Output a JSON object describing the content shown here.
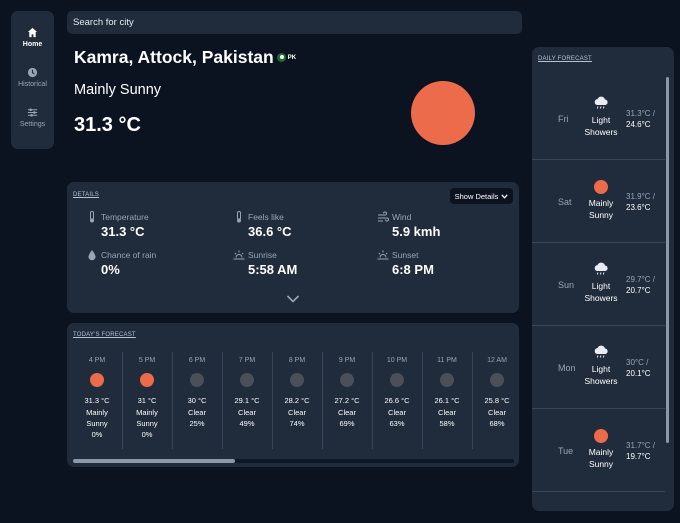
{
  "nav": {
    "items": [
      {
        "label": "Home",
        "icon": "home-icon",
        "active": true
      },
      {
        "label": "Historical",
        "icon": "clock-icon",
        "active": false
      },
      {
        "label": "Settings",
        "icon": "sliders-icon",
        "active": false
      }
    ]
  },
  "search": {
    "placeholder": "Search for city"
  },
  "current": {
    "city": "Kamra, Attock, Pakistan",
    "country_code": "PK",
    "condition": "Mainly Sunny",
    "temperature": "31.3 °C",
    "icon": "sun-icon"
  },
  "details": {
    "title": "DETAILS",
    "toggle_label": "Show Details",
    "items": [
      {
        "label": "Temperature",
        "value": "31.3 °C",
        "icon": "thermometer-icon"
      },
      {
        "label": "Feels like",
        "value": "36.6 °C",
        "icon": "thermometer-icon"
      },
      {
        "label": "Wind",
        "value": "5.9 kmh",
        "icon": "wind-icon"
      },
      {
        "label": "Chance of rain",
        "value": "0%",
        "icon": "raindrop-icon"
      },
      {
        "label": "Sunrise",
        "value": "5:58 AM",
        "icon": "sunrise-icon"
      },
      {
        "label": "Sunset",
        "value": "6:8 PM",
        "icon": "sunset-icon"
      }
    ]
  },
  "today": {
    "title": "TODAY'S FORECAST",
    "hours": [
      {
        "time": "4 PM",
        "temp": "31.3 °C",
        "cond1": "Mainly",
        "cond2": "Sunny",
        "rain": "0%",
        "icon": "sun-icon"
      },
      {
        "time": "5 PM",
        "temp": "31 °C",
        "cond1": "Mainly",
        "cond2": "Sunny",
        "rain": "0%",
        "icon": "sun-icon"
      },
      {
        "time": "6 PM",
        "temp": "30 °C",
        "cond1": "Clear",
        "cond2": "",
        "rain": "25%",
        "icon": "moon-icon"
      },
      {
        "time": "7 PM",
        "temp": "29.1 °C",
        "cond1": "Clear",
        "cond2": "",
        "rain": "49%",
        "icon": "moon-icon"
      },
      {
        "time": "8 PM",
        "temp": "28.2 °C",
        "cond1": "Clear",
        "cond2": "",
        "rain": "74%",
        "icon": "moon-icon"
      },
      {
        "time": "9 PM",
        "temp": "27.2 °C",
        "cond1": "Clear",
        "cond2": "",
        "rain": "69%",
        "icon": "moon-icon"
      },
      {
        "time": "10 PM",
        "temp": "26.6 °C",
        "cond1": "Clear",
        "cond2": "",
        "rain": "63%",
        "icon": "moon-icon"
      },
      {
        "time": "11 PM",
        "temp": "26.1 °C",
        "cond1": "Clear",
        "cond2": "",
        "rain": "58%",
        "icon": "moon-icon"
      },
      {
        "time": "12 AM",
        "temp": "25.8 °C",
        "cond1": "Clear",
        "cond2": "",
        "rain": "68%",
        "icon": "moon-icon"
      }
    ]
  },
  "daily": {
    "title": "DAILY FORECAST",
    "days": [
      {
        "day": "Fri",
        "cond1": "Light",
        "cond2": "Showers",
        "high": "31.3°C /",
        "low": "24.6°C",
        "icon": "cloud-rain-icon"
      },
      {
        "day": "Sat",
        "cond1": "Mainly",
        "cond2": "Sunny",
        "high": "31.9°C /",
        "low": "23.6°C",
        "icon": "sun-icon"
      },
      {
        "day": "Sun",
        "cond1": "Light",
        "cond2": "Showers",
        "high": "29.7°C /",
        "low": "20.7°C",
        "icon": "cloud-rain-icon"
      },
      {
        "day": "Mon",
        "cond1": "Light",
        "cond2": "Showers",
        "high": "30°C /",
        "low": "20.1°C",
        "icon": "cloud-rain-icon"
      },
      {
        "day": "Tue",
        "cond1": "Mainly",
        "cond2": "Sunny",
        "high": "31.7°C /",
        "low": "19.7°C",
        "icon": "sun-icon"
      }
    ]
  },
  "colors": {
    "background": "#0b1220",
    "panel": "#202b3b",
    "sun": "#ec6b4a",
    "moon": "#4a4f58",
    "muted_text": "#9aa4b5"
  }
}
